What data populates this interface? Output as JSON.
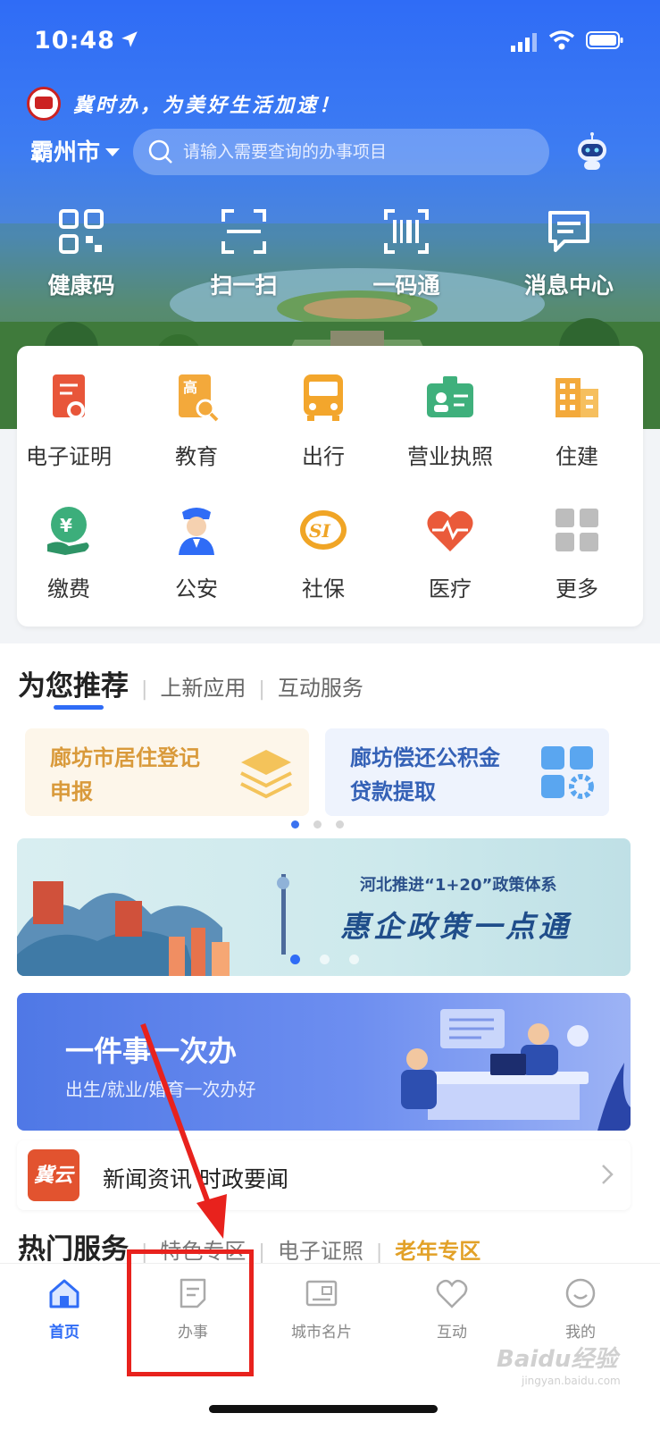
{
  "status_bar": {
    "time": "10:48"
  },
  "header": {
    "slogan": "冀时办，为美好生活加速！",
    "city": "霸州市",
    "search_placeholder": "请输入需要查询的办事项目"
  },
  "quick_actions": [
    {
      "label": "健康码",
      "icon": "qr-code-icon"
    },
    {
      "label": "扫一扫",
      "icon": "scan-icon"
    },
    {
      "label": "一码通",
      "icon": "barcode-icon"
    },
    {
      "label": "消息中心",
      "icon": "message-icon"
    }
  ],
  "services": [
    {
      "label": "电子证明",
      "icon": "certificate-icon"
    },
    {
      "label": "教育",
      "icon": "education-icon"
    },
    {
      "label": "出行",
      "icon": "bus-icon"
    },
    {
      "label": "营业执照",
      "icon": "license-icon"
    },
    {
      "label": "住建",
      "icon": "building-icon"
    },
    {
      "label": "缴费",
      "icon": "payment-icon"
    },
    {
      "label": "公安",
      "icon": "police-icon"
    },
    {
      "label": "社保",
      "icon": "social-security-icon"
    },
    {
      "label": "医疗",
      "icon": "heart-icon"
    },
    {
      "label": "更多",
      "icon": "grid-more-icon"
    }
  ],
  "recommend": {
    "tabs": [
      "为您推荐",
      "上新应用",
      "互动服务"
    ],
    "cards": [
      {
        "line1": "廊坊市居住登记",
        "line2": "申报"
      },
      {
        "line1": "廊坊偿还公积金",
        "line2": "贷款提取"
      }
    ]
  },
  "banner_policy": {
    "subtitle": "河北推进“1+20”政策体系",
    "title": "惠企政策一点通"
  },
  "banner_onething": {
    "title": "一件事一次办",
    "subtitle": "出生/就业/婚育一次办好"
  },
  "news": {
    "logo_text": "冀云",
    "text": "新闻资讯 时政要闻"
  },
  "hot": {
    "tabs": [
      "热门服务",
      "特色专区",
      "电子证照",
      "老年专区"
    ]
  },
  "bottom_nav": [
    {
      "label": "首页"
    },
    {
      "label": "办事"
    },
    {
      "label": "城市名片"
    },
    {
      "label": "互动"
    },
    {
      "label": "我的"
    }
  ],
  "watermark": {
    "text": "Baidu经验",
    "sub": "jingyan.baidu.com"
  },
  "colors": {
    "primary": "#2f6cf6",
    "annotation": "#e8221d",
    "accent_orange": "#e2a128"
  }
}
